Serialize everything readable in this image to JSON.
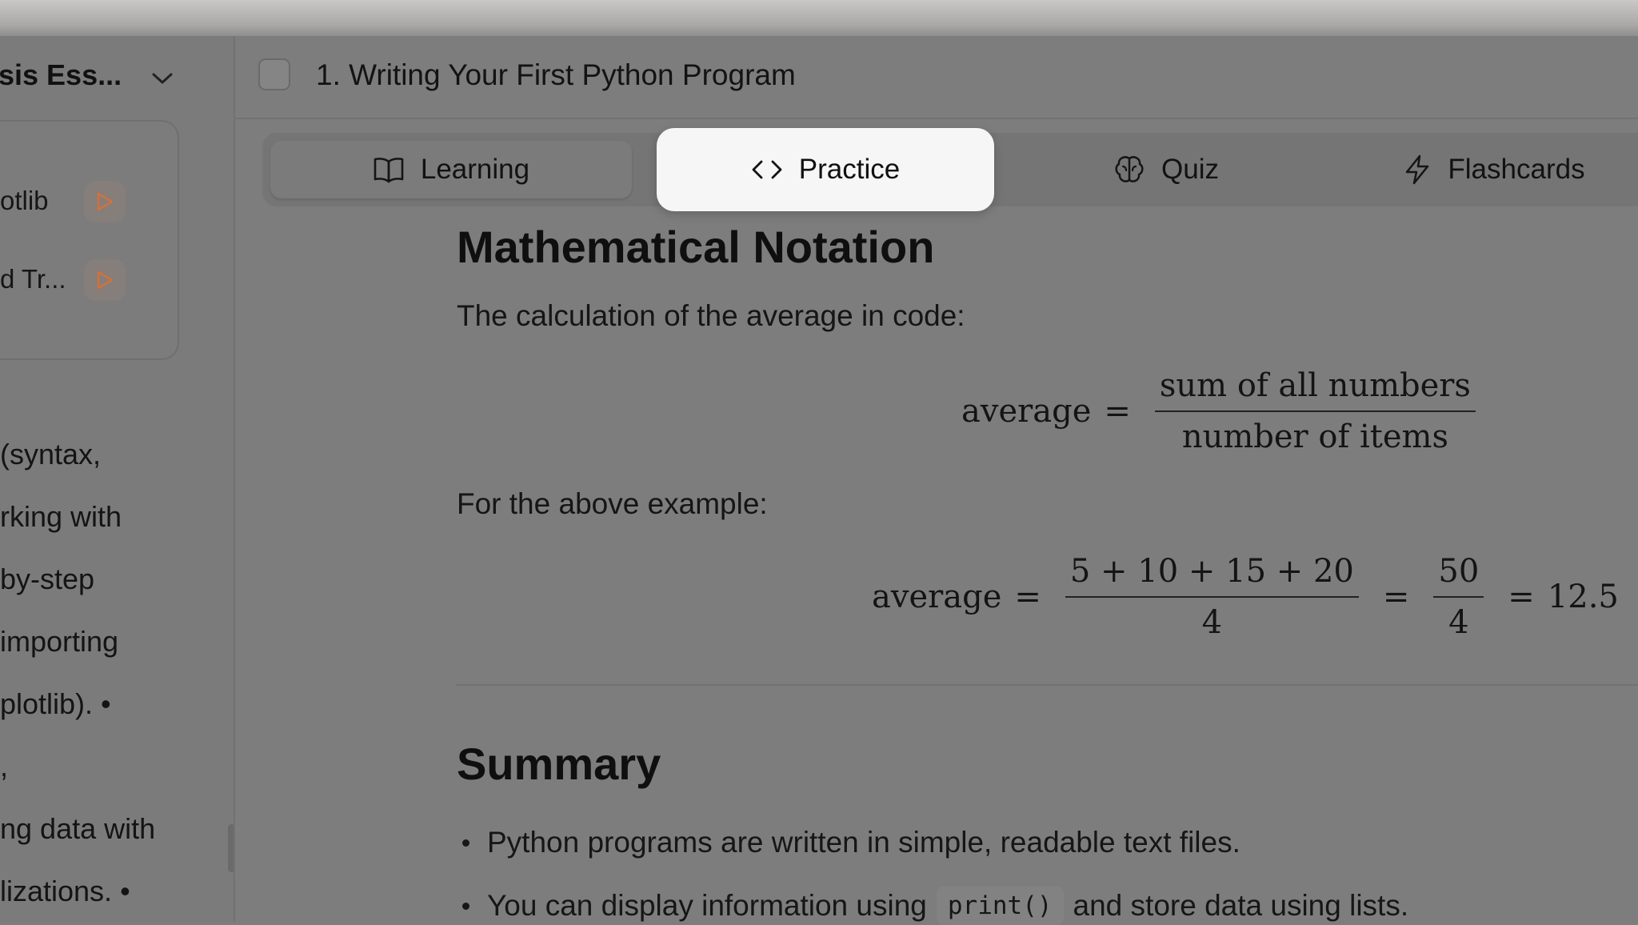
{
  "course": {
    "title": "sis Ess...",
    "lessons": [
      {
        "label": "otlib"
      },
      {
        "label": "d Tr..."
      }
    ]
  },
  "sidebar_text": [
    "(syntax,",
    "rking with",
    "by-step",
    " importing",
    "plotlib). •",
    ",",
    "ng data with",
    "lizations. •"
  ],
  "header": {
    "lesson_title": "1. Writing Your First Python Program"
  },
  "tabs": [
    {
      "label": "Learning",
      "icon": "book-open-icon",
      "active": false
    },
    {
      "label": "Practice",
      "icon": "code-icon",
      "active": true
    },
    {
      "label": "Quiz",
      "icon": "brain-icon",
      "active": false
    },
    {
      "label": "Flashcards",
      "icon": "lightning-icon",
      "active": false
    }
  ],
  "content": {
    "math_heading": "Mathematical Notation",
    "math_intro": "The calculation of the average in code:",
    "formula1": {
      "lhs": "average",
      "eq": "=",
      "numerator": "sum of all numbers",
      "denominator": "number of items"
    },
    "example_intro": "For the above example:",
    "formula2": {
      "lhs": "average",
      "eq": "=",
      "numerator": "5 + 10 + 15 + 20",
      "denominator": "4",
      "eq2": "=",
      "numerator2": "50",
      "denominator2": "4",
      "eq3": "=",
      "result": "12.5"
    },
    "summary_heading": "Summary",
    "bullets": [
      {
        "text": "Python programs are written in simple, readable text files."
      },
      {
        "before": "You can display information using",
        "code": "print()",
        "after": "and store data using lists."
      }
    ]
  }
}
